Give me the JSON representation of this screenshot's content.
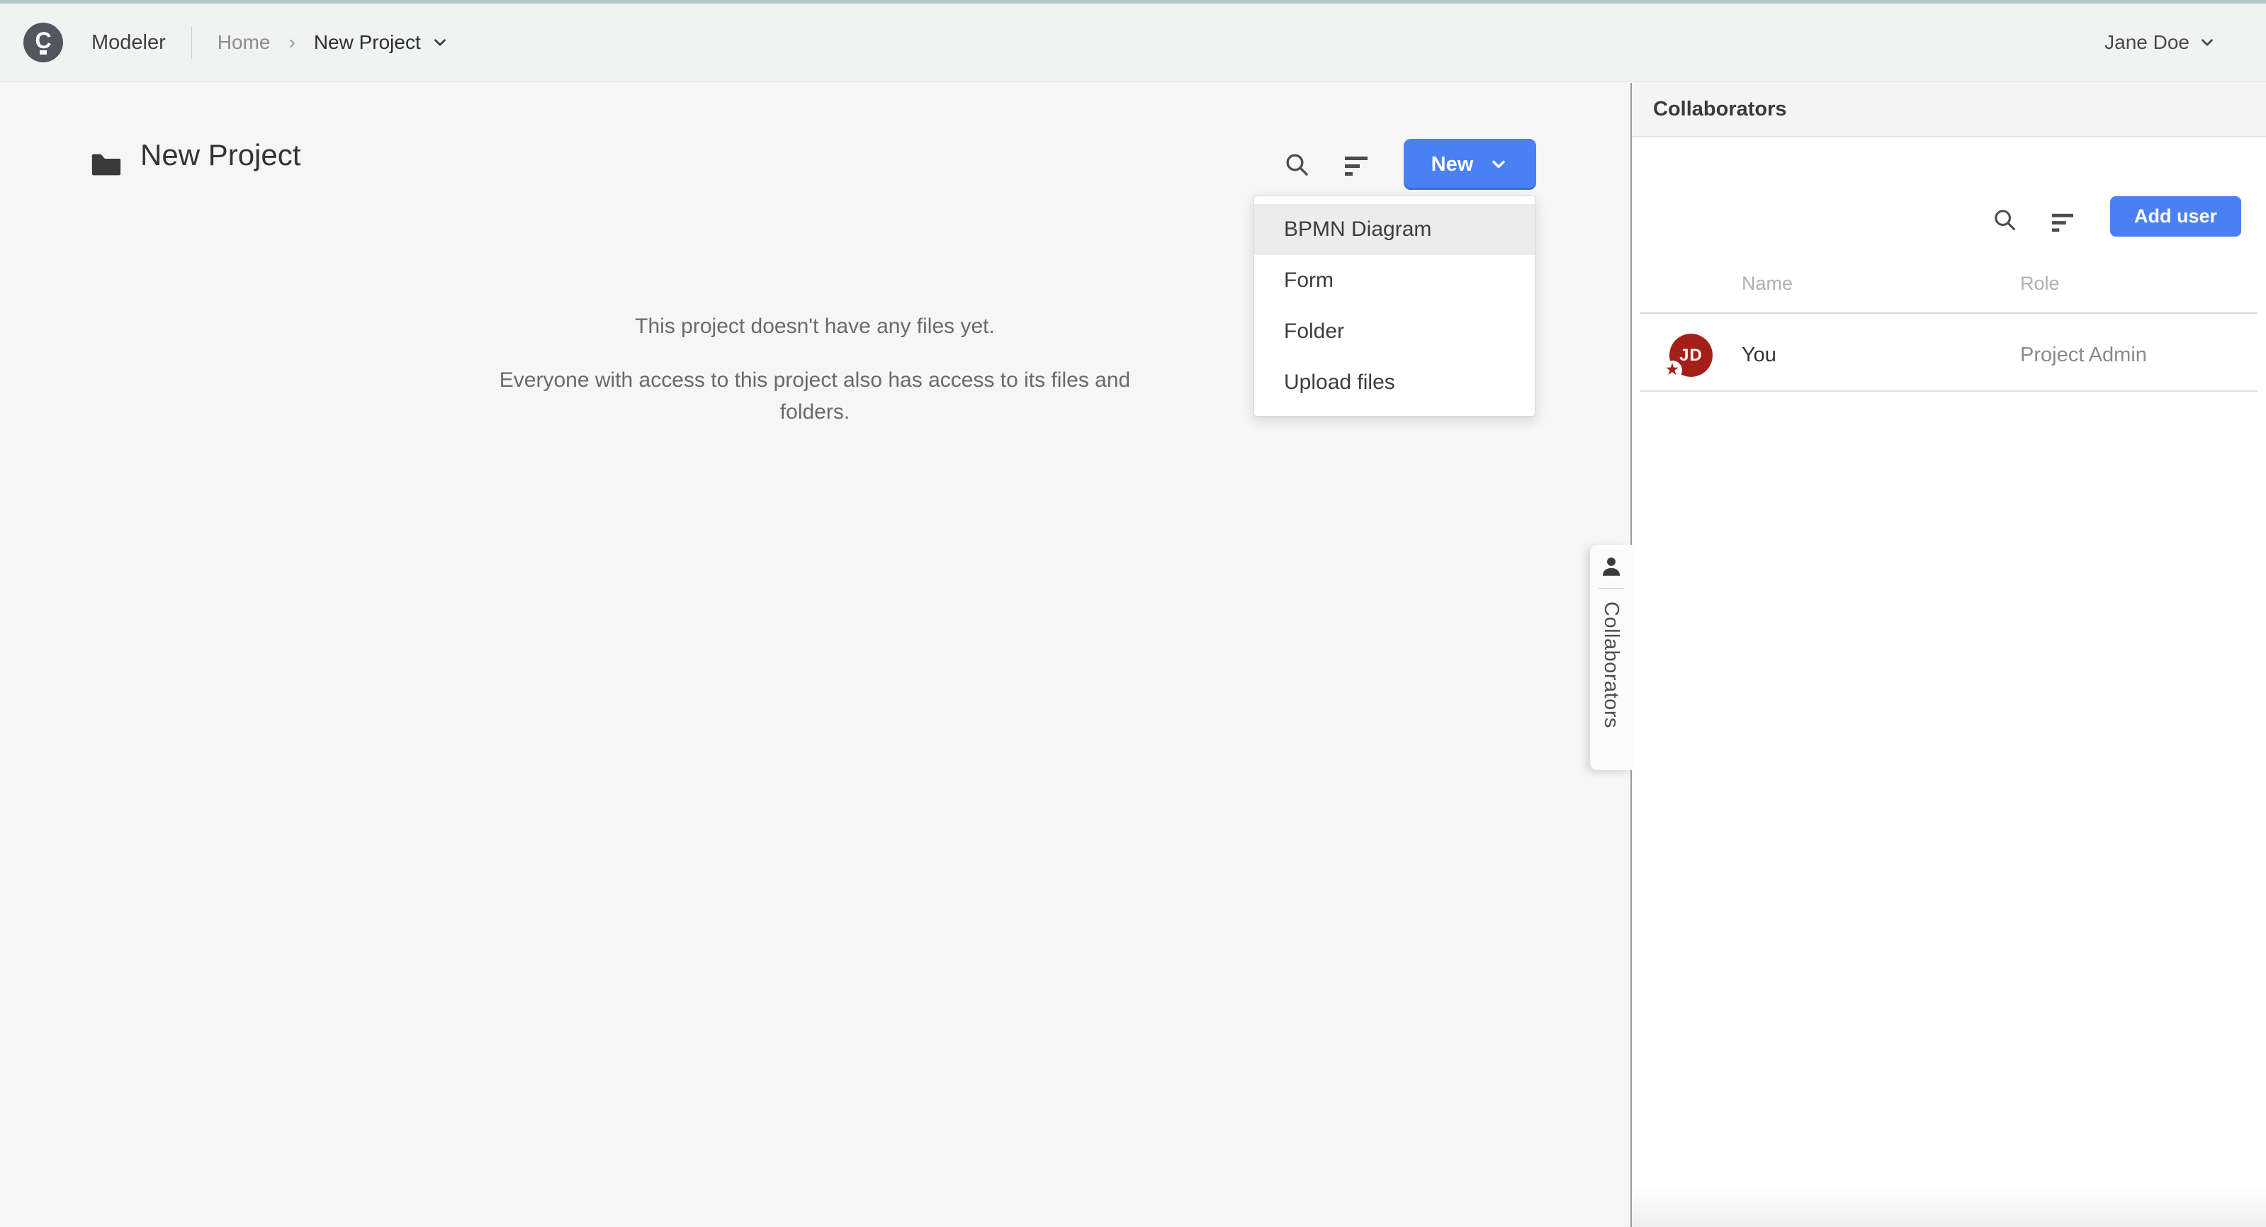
{
  "topbar": {
    "logo_letter": "C",
    "app_name": "Modeler",
    "breadcrumb": {
      "home": "Home",
      "separator": "›",
      "current": "New Project"
    },
    "user_name": "Jane Doe"
  },
  "main": {
    "page_title": "New Project",
    "new_button_label": "New",
    "new_menu": {
      "items": [
        "BPMN Diagram",
        "Form",
        "Folder",
        "Upload files"
      ],
      "highlighted_item": "BPMN Diagram"
    },
    "empty_state": {
      "line1": "This project doesn't have any files yet.",
      "line2": "Everyone with access to this project also has access to its files and",
      "line3": "folders."
    }
  },
  "collaborators": {
    "panel_title": "Collaborators",
    "tab_label": "Collaborators",
    "add_user_label": "Add user",
    "table": {
      "name_header": "Name",
      "role_header": "Role",
      "rows": [
        {
          "avatar_initials": "JD",
          "name": "You",
          "role": "Project Admin",
          "badge": "project-admin-star"
        }
      ]
    }
  },
  "icons": {
    "logo": "camunda-logo",
    "search": "magnifying-glass",
    "sort": "sort-lines-descending",
    "chevron": "chevron-down",
    "folder": "folder-filled",
    "person": "person-silhouette",
    "star_glyph": "★"
  },
  "colors": {
    "accent_blue": "#4a81f2",
    "avatar_red": "#a32018",
    "top_strip_teal": "#b5c7ca",
    "topbar_gray": "#f1f2f2",
    "main_background": "#f6f6f6"
  }
}
